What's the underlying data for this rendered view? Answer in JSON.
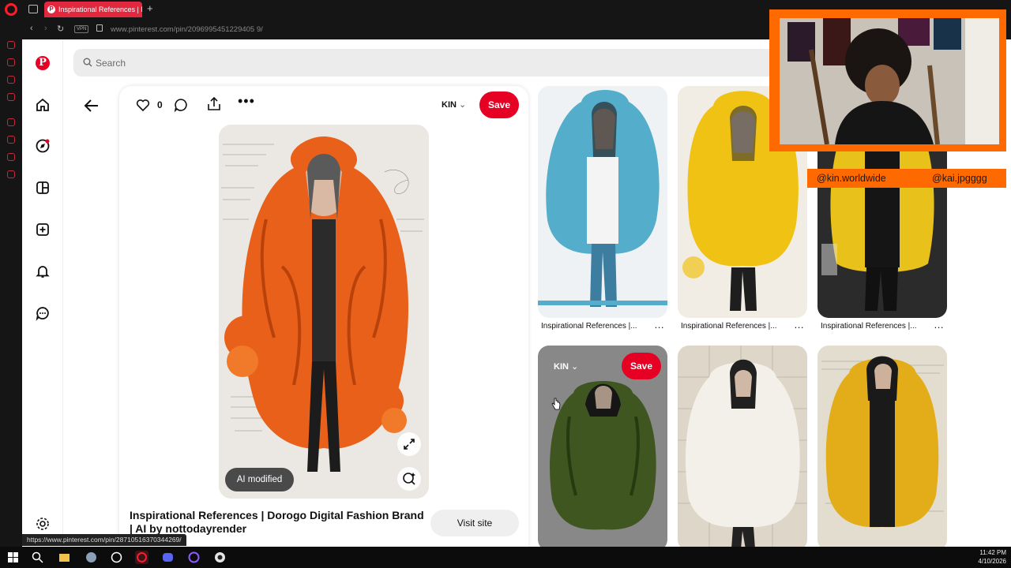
{
  "browser": {
    "tab_title": "Inspirational References | D",
    "tab_favicon_letter": "P",
    "vpn_label": "VPN",
    "url": "www.pinterest.com/pin/2096995451229405⁠ 9/",
    "status_url": "https://www.pinterest.com/pin/287105163703442​69/"
  },
  "search": {
    "placeholder": "Search"
  },
  "pin": {
    "like_count": "0",
    "board": "KIN",
    "save_label": "Save",
    "ai_badge": "AI modified",
    "title": "Inspirational References | Dorogo Digital Fashion Brand | AI by nottodayrender",
    "visit_label": "Visit site"
  },
  "related": [
    {
      "caption": "Inspirational References |...",
      "dots": "..."
    },
    {
      "caption": "Inspirational References |...",
      "dots": "..."
    },
    {
      "caption": "Inspirational References |...",
      "dots": "..."
    }
  ],
  "hover_tile": {
    "board": "KIN",
    "save_label": "Save"
  },
  "overlay": {
    "handle_left": "@kin.worldwide",
    "handle_right": "@kai.jpgggg"
  },
  "clock": {
    "time": "11:42 PM",
    "date": "4/10/2026"
  },
  "colors": {
    "pinterest_red": "#e60023",
    "overlay_orange": "#ff6a00"
  }
}
